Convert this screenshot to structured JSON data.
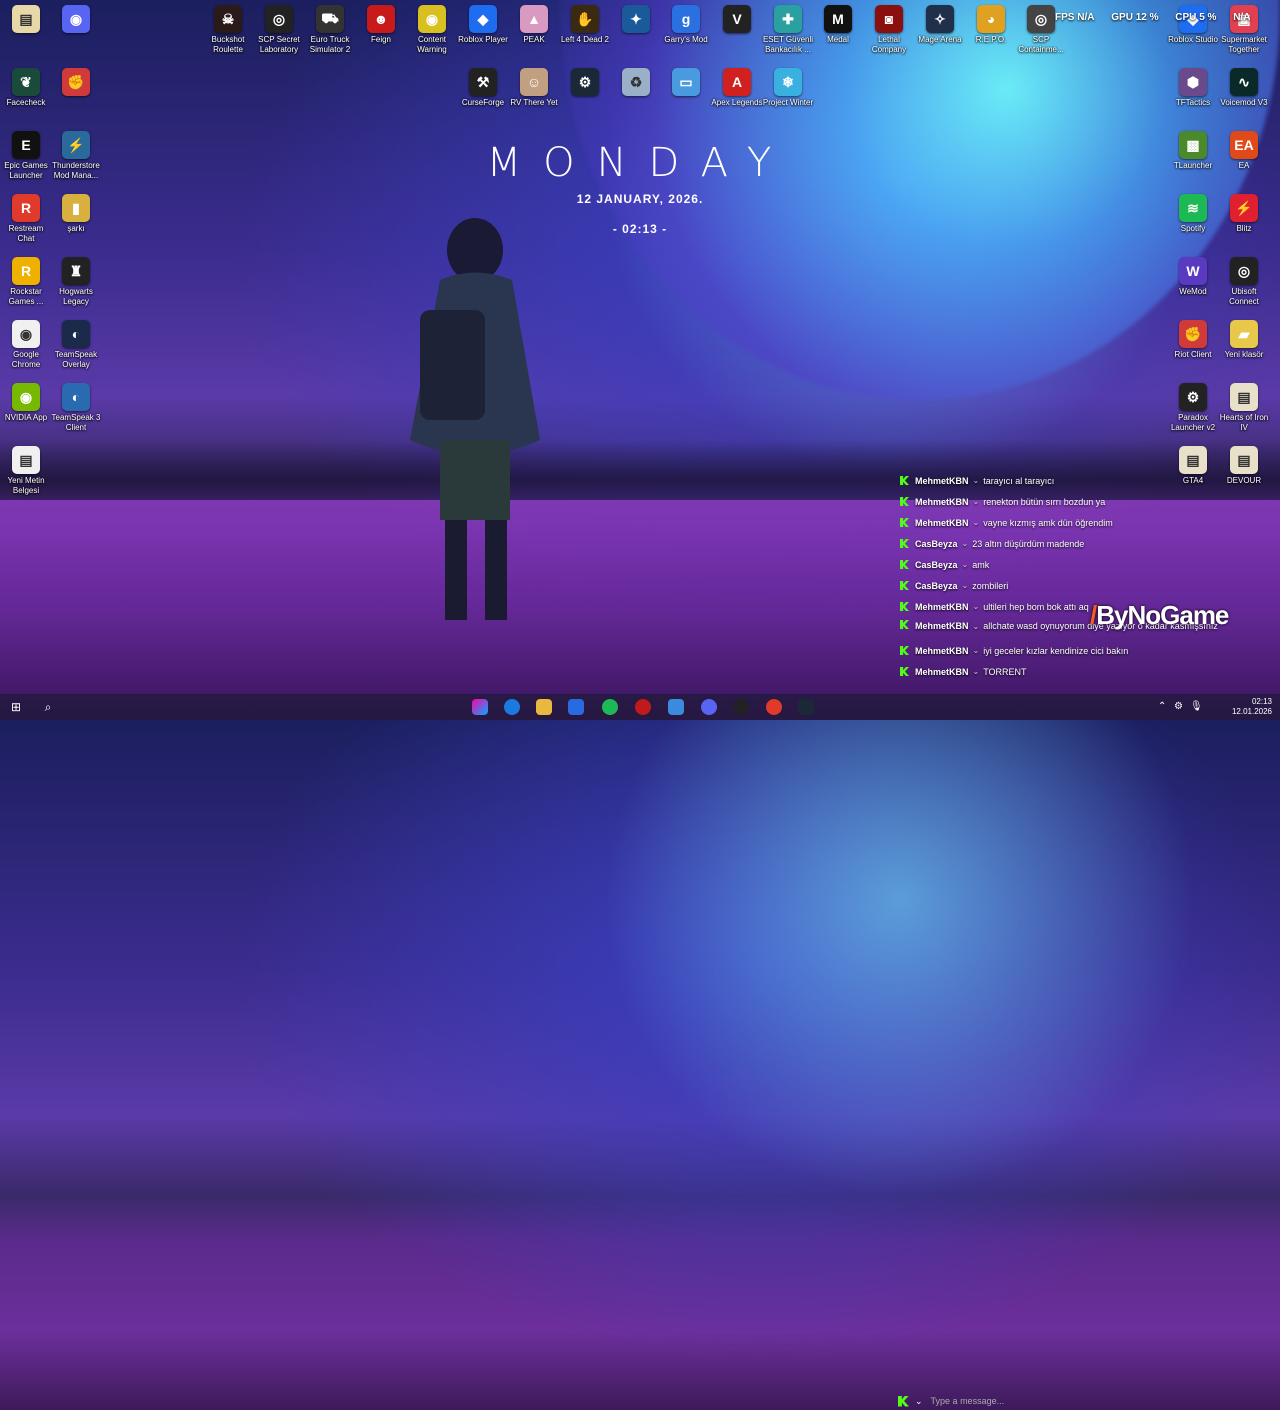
{
  "desktop": {
    "icons": [
      {
        "id": "doc",
        "label": "",
        "color": "#e8d8a8",
        "glyph": "▤"
      },
      {
        "id": "discord",
        "label": "",
        "color": "#5865f2",
        "glyph": "◉"
      },
      {
        "id": "buckshot",
        "label": "Buckshot Roulette",
        "color": "#2a1a1a",
        "glyph": "☠"
      },
      {
        "id": "scp-lab",
        "label": "SCP Secret Laboratory",
        "color": "#222",
        "glyph": "◎"
      },
      {
        "id": "ets2",
        "label": "Euro Truck Simulator 2",
        "color": "#333",
        "glyph": "⛟"
      },
      {
        "id": "feign",
        "label": "Feign",
        "color": "#c81a1a",
        "glyph": "☻"
      },
      {
        "id": "content-warning",
        "label": "Content Warning",
        "color": "#d8c020",
        "glyph": "◉"
      },
      {
        "id": "roblox-player",
        "label": "Roblox Player",
        "color": "#1e6cf0",
        "glyph": "◆"
      },
      {
        "id": "peak",
        "label": "PEAK",
        "color": "#d89ac0",
        "glyph": "▲"
      },
      {
        "id": "l4d2",
        "label": "Left 4 Dead 2",
        "color": "#3a2a10",
        "glyph": "✋"
      },
      {
        "id": "cs",
        "label": "",
        "color": "#1a5a9a",
        "glyph": "✦"
      },
      {
        "id": "gmod",
        "label": "Garry's Mod",
        "color": "#2a70e0",
        "glyph": "g"
      },
      {
        "id": "valorant",
        "label": "",
        "color": "#222",
        "glyph": "V"
      },
      {
        "id": "eset",
        "label": "ESET Güvenli Bankacılık ...",
        "color": "#2aa0a0",
        "glyph": "✚"
      },
      {
        "id": "medal",
        "label": "Medal",
        "color": "#111",
        "glyph": "M"
      },
      {
        "id": "lethal",
        "label": "Lethal Company",
        "color": "#8a1010",
        "glyph": "◙"
      },
      {
        "id": "mage-arena",
        "label": "Mage Arena",
        "color": "#20304a",
        "glyph": "✧"
      },
      {
        "id": "repo",
        "label": "R.E.P.O.",
        "color": "#e0a020",
        "glyph": "◕"
      },
      {
        "id": "scp-cb",
        "label": "SCP Containme...",
        "color": "#444",
        "glyph": "◎"
      },
      {
        "id": "roblox-studio",
        "label": "Roblox Studio",
        "color": "#1e6cf0",
        "glyph": "◆"
      },
      {
        "id": "supermarket",
        "label": "Supermarket Together",
        "color": "#e04050",
        "glyph": "▣"
      },
      {
        "id": "facecheck",
        "label": "Facecheck",
        "color": "#1a4a3a",
        "glyph": "❦"
      },
      {
        "id": "riot-top",
        "label": "",
        "color": "#d13a3a",
        "glyph": "✊"
      },
      {
        "id": "curseforge",
        "label": "CurseForge",
        "color": "#222",
        "glyph": "⚒"
      },
      {
        "id": "rv-there-yet",
        "label": "RV There Yet",
        "color": "#c0a080",
        "glyph": "☺"
      },
      {
        "id": "steam-top",
        "label": "",
        "color": "#1b2838",
        "glyph": "⚙"
      },
      {
        "id": "recycle",
        "label": "",
        "color": "#9ab0c8",
        "glyph": "♻"
      },
      {
        "id": "this-pc",
        "label": "",
        "color": "#4a9ae0",
        "glyph": "▭"
      },
      {
        "id": "apex",
        "label": "Apex Legends",
        "color": "#d02020",
        "glyph": "A"
      },
      {
        "id": "project-winter",
        "label": "Project Winter",
        "color": "#3ab0e0",
        "glyph": "❄"
      },
      {
        "id": "tftactics",
        "label": "TFTactics",
        "color": "#6a4a8a",
        "glyph": "⬢"
      },
      {
        "id": "voicemod",
        "label": "Voicemod V3",
        "color": "#0a2a2a",
        "glyph": "∿"
      },
      {
        "id": "epic",
        "label": "Epic Games Launcher",
        "color": "#111",
        "glyph": "E"
      },
      {
        "id": "thunderstore",
        "label": "Thunderstore Mod Mana...",
        "color": "#2a6a9a",
        "glyph": "⚡"
      },
      {
        "id": "tlauncher",
        "label": "TLauncher",
        "color": "#4a8a2a",
        "glyph": "▩"
      },
      {
        "id": "ea",
        "label": "EA",
        "color": "#e04a1a",
        "glyph": "EA"
      },
      {
        "id": "restream",
        "label": "Restream Chat",
        "color": "#e03a2a",
        "glyph": "R"
      },
      {
        "id": "sarki",
        "label": "şarkı",
        "color": "#d8b040",
        "glyph": "▮"
      },
      {
        "id": "spotify",
        "label": "Spotify",
        "color": "#1db954",
        "glyph": "≋"
      },
      {
        "id": "blitz",
        "label": "Blitz",
        "color": "#e02030",
        "glyph": "⚡"
      },
      {
        "id": "rockstar",
        "label": "Rockstar Games ...",
        "color": "#f0b000",
        "glyph": "R"
      },
      {
        "id": "hogwarts",
        "label": "Hogwarts Legacy",
        "color": "#222",
        "glyph": "♜"
      },
      {
        "id": "wemod",
        "label": "WeMod",
        "color": "#5a3ac0",
        "glyph": "W"
      },
      {
        "id": "ubisoft",
        "label": "Ubisoft Connect",
        "color": "#222",
        "glyph": "◎"
      },
      {
        "id": "chrome",
        "label": "Google Chrome",
        "color": "#f0f0f0",
        "glyph": "◉"
      },
      {
        "id": "teamspeak-overlay",
        "label": "TeamSpeak Overlay",
        "color": "#1a2a4a",
        "glyph": "◐"
      },
      {
        "id": "riot-client",
        "label": "Riot Client",
        "color": "#d13a3a",
        "glyph": "✊"
      },
      {
        "id": "yeni-klasor",
        "label": "Yeni klasör",
        "color": "#e8c84a",
        "glyph": "▰"
      },
      {
        "id": "nvidia",
        "label": "NVIDIA App",
        "color": "#76b900",
        "glyph": "◉"
      },
      {
        "id": "teamspeak3",
        "label": "TeamSpeak 3 Client",
        "color": "#2a6ab0",
        "glyph": "◐"
      },
      {
        "id": "paradox",
        "label": "Paradox Launcher v2",
        "color": "#222",
        "glyph": "⚙"
      },
      {
        "id": "hoi4",
        "label": "Hearts of Iron IV",
        "color": "#e8e0c8",
        "glyph": "▤"
      },
      {
        "id": "yeni-metin",
        "label": "Yeni Metin Belgesi",
        "color": "#f0f0f0",
        "glyph": "▤"
      },
      {
        "id": "gta4",
        "label": "GTA4",
        "color": "#e8e0c8",
        "glyph": "▤"
      },
      {
        "id": "devour",
        "label": "DEVOUR",
        "color": "#e8e0c8",
        "glyph": "▤"
      }
    ]
  },
  "clock": {
    "day": "MONDAY",
    "date": "12 JANUARY, 2026.",
    "time": "- 02:13 -"
  },
  "perf": {
    "fps_label": "FPS",
    "fps_value": "N/A",
    "gpu_label": "GPU",
    "gpu_value": "12 %",
    "cpu_label": "CPU",
    "cpu_value": "5 %",
    "extra_value": "N/A"
  },
  "chat": {
    "messages": [
      {
        "user": "MehmetKBN",
        "text": "tarayıcı al tarayıcı"
      },
      {
        "user": "MehmetKBN",
        "text": "renekton bütün sırrı bozdun ya"
      },
      {
        "user": "MehmetKBN",
        "text": "vayne kızmış amk dün öğrendim"
      },
      {
        "user": "CasBeyza",
        "text": "23 altın düşürdüm madende"
      },
      {
        "user": "CasBeyza",
        "text": "amk"
      },
      {
        "user": "CasBeyza",
        "text": "zombileri"
      },
      {
        "user": "MehmetKBN",
        "text": "ultileri hep bom bok attı aq"
      },
      {
        "user": "MehmetKBN",
        "text": "allchate wasd oynuyorum diye yazıyor o kadar kasmışsınız"
      },
      {
        "user": "MehmetKBN",
        "text": "iyi geceler kızlar kendinize cici bakın"
      },
      {
        "user": "MehmetKBN",
        "text": "TORRENT"
      }
    ],
    "input_placeholder": "Type a message..."
  },
  "watermark": {
    "text": "ByNoGame"
  },
  "taskbar": {
    "time": "02:13",
    "date": "12.01.2026"
  }
}
